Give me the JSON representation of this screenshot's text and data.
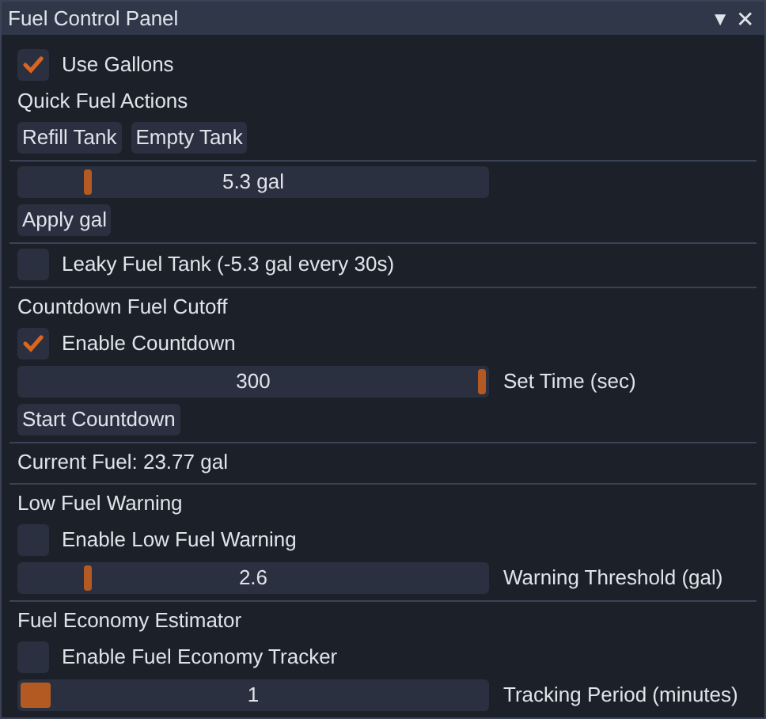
{
  "window": {
    "title": "Fuel Control Panel",
    "collapse_glyph": "▼",
    "close_glyph": "✕"
  },
  "items": [
    {
      "kind": "checkbox",
      "label": "Use Gallons",
      "checked": true
    },
    {
      "kind": "text",
      "text": "Quick Fuel Actions"
    },
    {
      "kind": "buttons",
      "labels": [
        "Refill Tank",
        "Empty Tank"
      ]
    },
    {
      "kind": "separator"
    },
    {
      "kind": "slider",
      "readout": "5.3 gal",
      "level": 0.14
    },
    {
      "kind": "buttons",
      "labels": [
        "Apply gal"
      ]
    },
    {
      "kind": "separator"
    },
    {
      "kind": "checkbox",
      "label": "Leaky Fuel Tank (-5.3 gal every 30s)",
      "checked": false
    },
    {
      "kind": "separator"
    },
    {
      "kind": "text",
      "text": "Countdown Fuel Cutoff"
    },
    {
      "kind": "checkbox",
      "label": "Enable Countdown",
      "checked": true
    },
    {
      "kind": "slider",
      "readout": "300",
      "level": 1,
      "caption": "Set Time (sec)"
    },
    {
      "kind": "buttons",
      "labels": [
        "Start Countdown"
      ]
    },
    {
      "kind": "separator"
    },
    {
      "kind": "text",
      "text": "Current Fuel: 23.77 gal"
    },
    {
      "kind": "separator"
    },
    {
      "kind": "text",
      "text": "Low Fuel Warning"
    },
    {
      "kind": "checkbox",
      "label": "Enable Low Fuel Warning",
      "checked": false
    },
    {
      "kind": "slider",
      "readout": "2.6",
      "level": 0.14,
      "caption": "Warning Threshold (gal)"
    },
    {
      "kind": "separator"
    },
    {
      "kind": "text",
      "text": "Fuel Economy Estimator"
    },
    {
      "kind": "checkbox",
      "label": "Enable Fuel Economy Tracker",
      "checked": false
    },
    {
      "kind": "coarse_slider",
      "readout": "1",
      "level": 0,
      "caption": "Tracking Period (minutes)"
    }
  ]
}
